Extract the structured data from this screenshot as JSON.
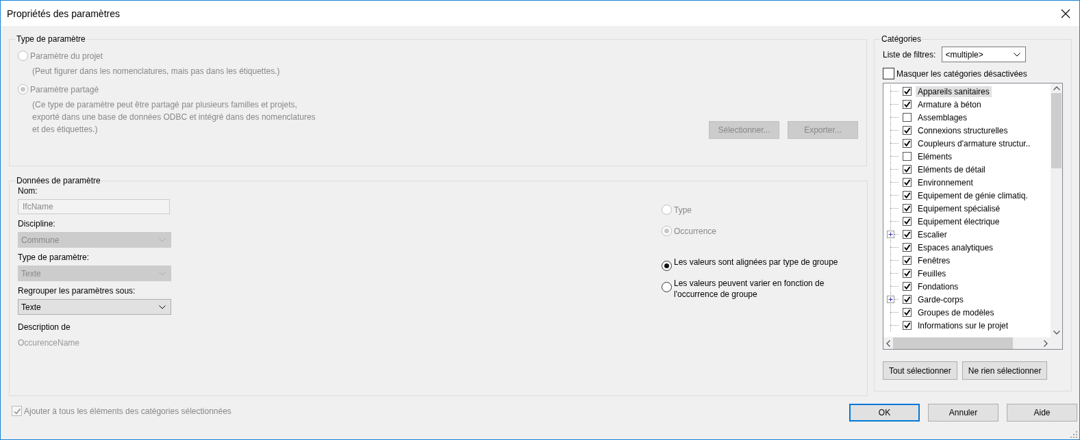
{
  "window": {
    "title": "Propriétés des paramètres"
  },
  "parameter_type": {
    "legend": "Type de paramètre",
    "options": [
      {
        "label": "Paramètre du projet",
        "selected": false,
        "disabled": true,
        "note": "(Peut figurer dans les nomenclatures, mais pas dans les étiquettes.)"
      },
      {
        "label": "Paramètre partagé",
        "selected": true,
        "disabled": true,
        "note": "(Ce type de paramètre peut être partagé par plusieurs familles et projets, exporté dans une base de données ODBC et intégré dans des nomenclatures et des étiquettes.)"
      }
    ],
    "buttons": [
      {
        "label": "Sélectionner...",
        "disabled": true
      },
      {
        "label": "Exporter...",
        "disabled": true
      }
    ]
  },
  "parameter_data": {
    "legend": "Données de paramètre",
    "fields": [
      {
        "kind": "text",
        "label": "Nom:",
        "value": "IfcName",
        "disabled": true
      },
      {
        "kind": "dropdown",
        "label": "Discipline:",
        "value": "Commune",
        "disabled": true
      },
      {
        "kind": "dropdown",
        "label": "Type de paramètre:",
        "value": "Texte",
        "disabled": true
      },
      {
        "kind": "dropdown",
        "label": "Regrouper les paramètres sous:",
        "value": "Texte",
        "disabled": false
      }
    ],
    "description_label": "Description de",
    "description_value": "OccurenceName",
    "instance_options": [
      {
        "label": "Type",
        "selected": false,
        "disabled": true
      },
      {
        "label": "Occurrence",
        "selected": true,
        "disabled": true
      }
    ],
    "group_options": [
      {
        "label": "Les valeurs sont alignées par type de groupe",
        "selected": true,
        "disabled": false
      },
      {
        "label": "Les valeurs peuvent varier en fonction de l'occurrence de groupe",
        "selected": false,
        "disabled": false
      }
    ]
  },
  "add_to_all": {
    "label": "Ajouter à tous les éléments des catégories sélectionnées",
    "checked": true,
    "disabled": true
  },
  "categories": {
    "legend": "Catégories",
    "filter_label": "Liste de filtres:",
    "filter_value": "<multiple>",
    "hide_disabled": {
      "label": "Masquer les catégories désactivées",
      "checked": false
    },
    "items": [
      {
        "label": "Appareils sanitaires",
        "checked": true,
        "selected": true,
        "kind": "leaf"
      },
      {
        "label": "Armature à béton",
        "checked": true,
        "selected": false,
        "kind": "leaf"
      },
      {
        "label": "Assemblages",
        "checked": false,
        "selected": false,
        "kind": "leaf"
      },
      {
        "label": "Connexions structurelles",
        "checked": true,
        "selected": false,
        "kind": "leaf"
      },
      {
        "label": "Coupleurs d'armature structur..",
        "checked": true,
        "selected": false,
        "kind": "leaf"
      },
      {
        "label": "Eléments",
        "checked": false,
        "selected": false,
        "kind": "leaf"
      },
      {
        "label": "Eléments de détail",
        "checked": true,
        "selected": false,
        "kind": "leaf"
      },
      {
        "label": "Environnement",
        "checked": true,
        "selected": false,
        "kind": "leaf"
      },
      {
        "label": "Equipement de génie climatiq.",
        "checked": true,
        "selected": false,
        "kind": "leaf"
      },
      {
        "label": "Equipement spécialisé",
        "checked": true,
        "selected": false,
        "kind": "leaf"
      },
      {
        "label": "Equipement électrique",
        "checked": true,
        "selected": false,
        "kind": "leaf"
      },
      {
        "label": "Escalier",
        "checked": true,
        "selected": false,
        "kind": "group"
      },
      {
        "label": "Espaces analytiques",
        "checked": true,
        "selected": false,
        "kind": "leaf"
      },
      {
        "label": "Fenêtres",
        "checked": true,
        "selected": false,
        "kind": "leaf"
      },
      {
        "label": "Feuilles",
        "checked": true,
        "selected": false,
        "kind": "leaf"
      },
      {
        "label": "Fondations",
        "checked": true,
        "selected": false,
        "kind": "leaf"
      },
      {
        "label": "Garde-corps",
        "checked": true,
        "selected": false,
        "kind": "group"
      },
      {
        "label": "Groupes de modèles",
        "checked": true,
        "selected": false,
        "kind": "leaf"
      },
      {
        "label": "Informations sur le projet",
        "checked": true,
        "selected": false,
        "kind": "leaf"
      }
    ],
    "buttons": [
      "Tout sélectionner",
      "Ne rien sélectionner"
    ]
  },
  "buttons": [
    {
      "label": "OK",
      "default": true
    },
    {
      "label": "Annuler",
      "default": false
    },
    {
      "label": "Aide",
      "default": false
    }
  ]
}
